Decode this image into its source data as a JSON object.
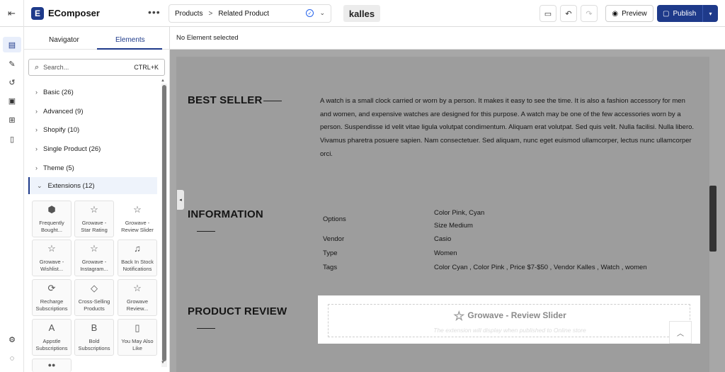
{
  "topbar": {
    "app_name": "EComposer",
    "more": "•••",
    "breadcrumb": {
      "parent": "Products",
      "separator": ">",
      "current": "Related Product"
    },
    "brand": "kalles",
    "preview_label": "Preview",
    "publish_label": "Publish"
  },
  "panel": {
    "tabs": {
      "navigator": "Navigator",
      "elements": "Elements"
    },
    "search": {
      "placeholder": "Search...",
      "shortcut": "CTRL+K"
    },
    "categories": [
      {
        "label": "Basic (26)"
      },
      {
        "label": "Advanced (9)"
      },
      {
        "label": "Shopify (10)"
      },
      {
        "label": "Single Product (26)"
      },
      {
        "label": "Theme (5)"
      },
      {
        "label": "Extensions (12)"
      }
    ],
    "tiles": [
      {
        "line1": "Frequently",
        "line2": "Bought...",
        "icon": "box-icon"
      },
      {
        "line1": "Growave -",
        "line2": "Star Rating",
        "icon": "star-icon"
      },
      {
        "line1": "Growave -",
        "line2": "Review Slider",
        "icon": "star-icon"
      },
      {
        "line1": "Growave -",
        "line2": "Wishlist...",
        "icon": "star-icon"
      },
      {
        "line1": "Growave -",
        "line2": "Instagram...",
        "icon": "star-icon"
      },
      {
        "line1": "Back In Stock",
        "line2": "Notifications",
        "icon": "bell-icon"
      },
      {
        "line1": "Recharge",
        "line2": "Subscriptions",
        "icon": "refresh-icon"
      },
      {
        "line1": "Cross-Selling",
        "line2": "Products",
        "icon": "tags-icon"
      },
      {
        "line1": "Growave",
        "line2": "Review...",
        "icon": "star-icon"
      },
      {
        "line1": "Appstle",
        "line2": "Subscriptions",
        "icon": "letter-a-icon"
      },
      {
        "line1": "Bold",
        "line2": "Subscriptions",
        "icon": "letter-b-icon"
      },
      {
        "line1": "You May Also",
        "line2": "Like",
        "icon": "cards-icon"
      }
    ]
  },
  "canvas": {
    "status": "No Element selected",
    "best_seller": {
      "title": "BEST SELLER",
      "description": "A watch is a small clock carried or worn by a person. It makes it easy to see the time. It is also a fashion accessory for men and women, and expensive watches are designed for this purpose. A watch may be one of the few accessories worn by a person. Suspendisse id velit vitae ligula volutpat condimentum. Aliquam erat volutpat. Sed quis velit. Nulla facilisi. Nulla libero. Vivamus pharetra posuere sapien. Nam consectetuer. Sed aliquam, nunc eget euismod ullamcorper, lectus nunc ullamcorper orci."
    },
    "information": {
      "title": "INFORMATION",
      "rows": [
        {
          "label": "Options",
          "value": "Color Pink, Cyan",
          "value2": "Size Medium"
        },
        {
          "label": "Vendor",
          "value": "Casio"
        },
        {
          "label": "Type",
          "value": "Women"
        },
        {
          "label": "Tags",
          "value": "Color Cyan , Color Pink , Price $7-$50 , Vendor Kalles , Watch , women"
        }
      ]
    },
    "product_review": {
      "title": "PRODUCT REVIEW",
      "widget_title": "Growave - Review Slider",
      "widget_sub": "The extension will display when published to Online store"
    }
  }
}
